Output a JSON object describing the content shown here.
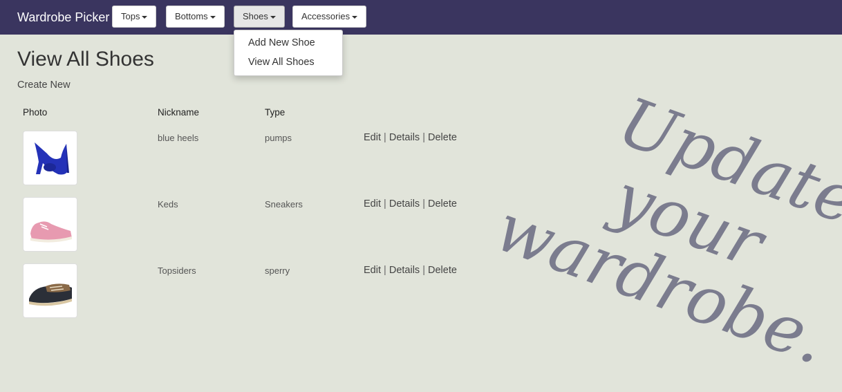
{
  "navbar": {
    "brand": "Wardrobe Picker",
    "menus": [
      {
        "label": "Tops"
      },
      {
        "label": "Bottoms"
      },
      {
        "label": "Shoes"
      },
      {
        "label": "Accessories"
      }
    ],
    "shoes_dropdown": [
      "Add New Shoe",
      "View All Shoes"
    ]
  },
  "page": {
    "title": "View All Shoes",
    "create_link": "Create New"
  },
  "table": {
    "headers": {
      "photo": "Photo",
      "nickname": "Nickname",
      "type": "Type"
    },
    "rows": [
      {
        "photo_icon": "blue-heel-shoe-photo",
        "nickname": "blue heels",
        "type": "pumps"
      },
      {
        "photo_icon": "pink-sneaker-photo",
        "nickname": "Keds",
        "type": "Sneakers"
      },
      {
        "photo_icon": "boat-shoe-photo",
        "nickname": "Topsiders",
        "type": "sperry"
      }
    ],
    "action_labels": {
      "edit": "Edit",
      "details": "Details",
      "delete": "Delete",
      "separator": "|"
    }
  },
  "decor": {
    "line1": "Update",
    "line2": "your",
    "line3": "wardrobe."
  },
  "colors": {
    "navbar": "#3a355f",
    "background": "#e1e4da",
    "script": "#7b7c8e"
  }
}
